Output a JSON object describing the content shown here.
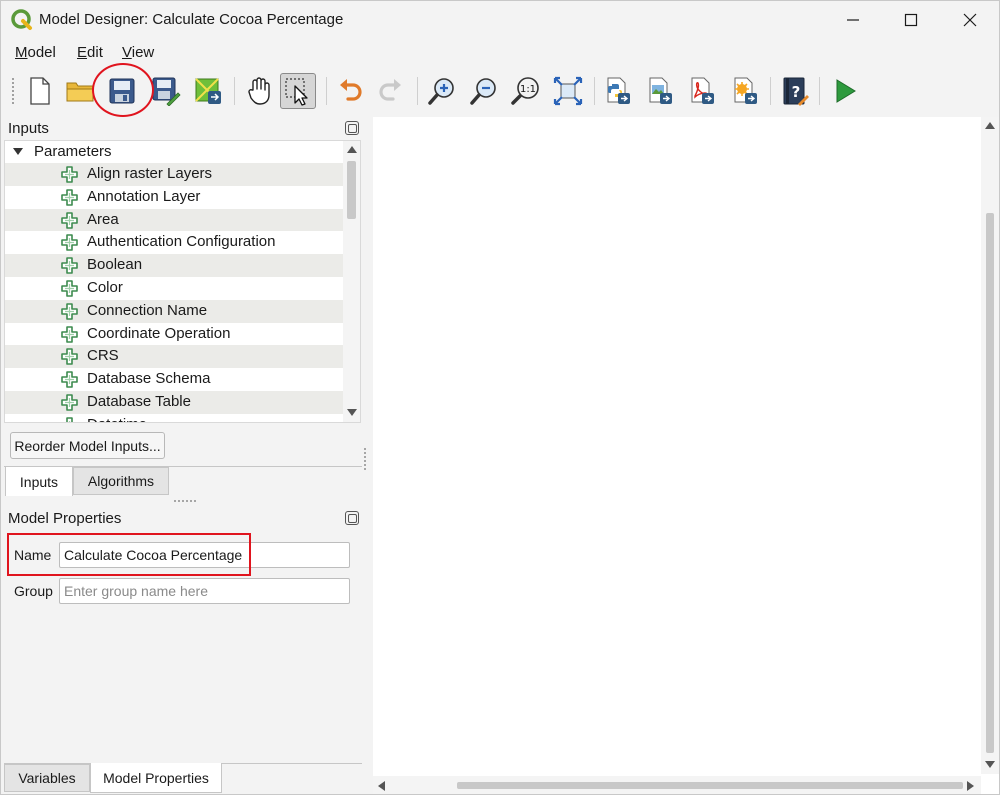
{
  "window": {
    "title": "Model Designer: Calculate Cocoa Percentage"
  },
  "menu": {
    "model": "Model",
    "model_mnemonic": "M",
    "model_rest": "odel",
    "edit_mnemonic": "E",
    "edit_rest": "dit",
    "view_mnemonic": "V",
    "view_rest": "iew"
  },
  "inputs_panel": {
    "title": "Inputs",
    "root_label": "Parameters",
    "items": [
      "Align raster Layers",
      "Annotation Layer",
      "Area",
      "Authentication Configuration",
      "Boolean",
      "Color",
      "Connection Name",
      "Coordinate Operation",
      "CRS",
      "Database Schema",
      "Database Table",
      "Datetime"
    ],
    "reorder_button": "Reorder Model Inputs...",
    "tabs": [
      "Inputs",
      "Algorithms"
    ]
  },
  "model_properties": {
    "title": "Model Properties",
    "name_label": "Name",
    "name_value": "Calculate Cocoa Percentage",
    "group_label": "Group",
    "group_placeholder": "Enter group name here"
  },
  "bottom_tabs": [
    "Variables",
    "Model Properties"
  ],
  "colors": {
    "highlight": "#e0141e",
    "run_green": "#2e9a3e",
    "plus_green": "#3d8b4f"
  }
}
